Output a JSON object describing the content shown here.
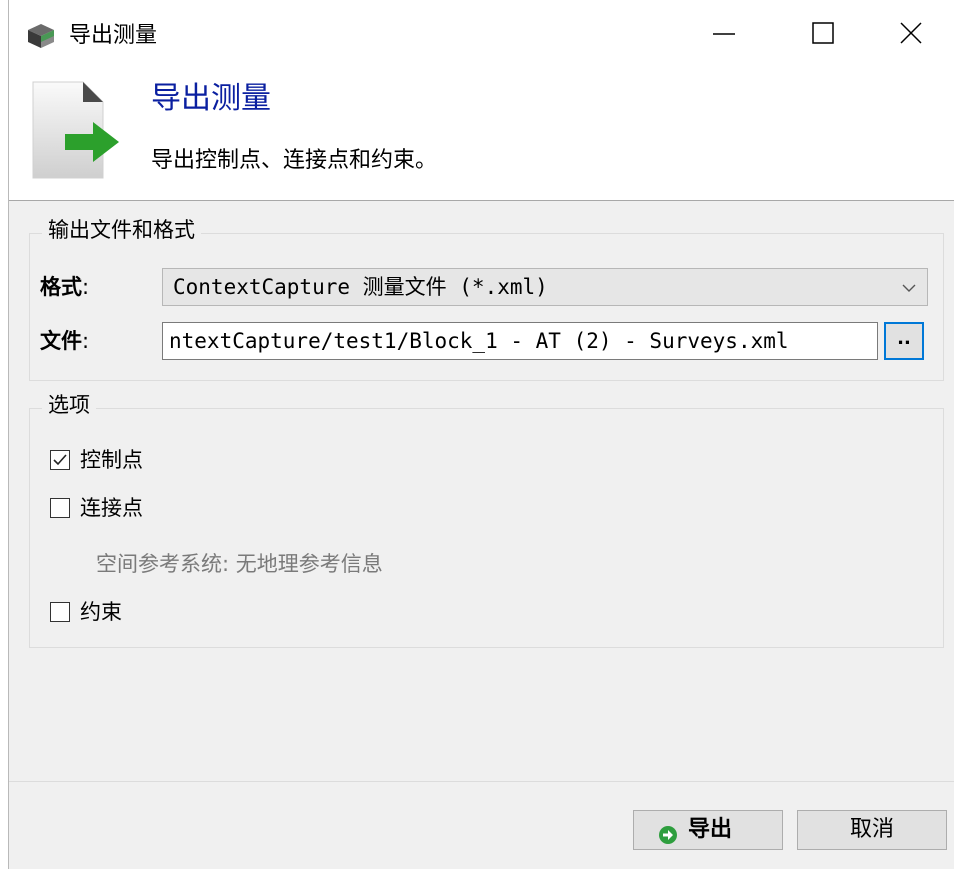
{
  "window": {
    "title": "导出测量"
  },
  "header": {
    "title": "导出测量",
    "subtitle": "导出控制点、连接点和约束。"
  },
  "output_group": {
    "label": "输出文件和格式",
    "format_label": "格式",
    "format_value": "ContextCapture 测量文件 (*.xml)",
    "file_label": "文件",
    "file_value": "ntextCapture/test1/Block_1 - AT (2) - Surveys.xml",
    "browse_label": ".."
  },
  "options_group": {
    "label": "选项",
    "control_points": {
      "label": "控制点",
      "checked": true
    },
    "tie_points": {
      "label": "连接点",
      "checked": false
    },
    "srs_info": "空间参考系统: 无地理参考信息",
    "constraints": {
      "label": "约束",
      "checked": false
    }
  },
  "footer": {
    "export_label": "导出",
    "cancel_label": "取消"
  },
  "colors": {
    "header_title": "#0a1fa0",
    "accent_border": "#0078d7",
    "export_icon": "#2e9e3e",
    "doc_arrow": "#2ca02c"
  }
}
